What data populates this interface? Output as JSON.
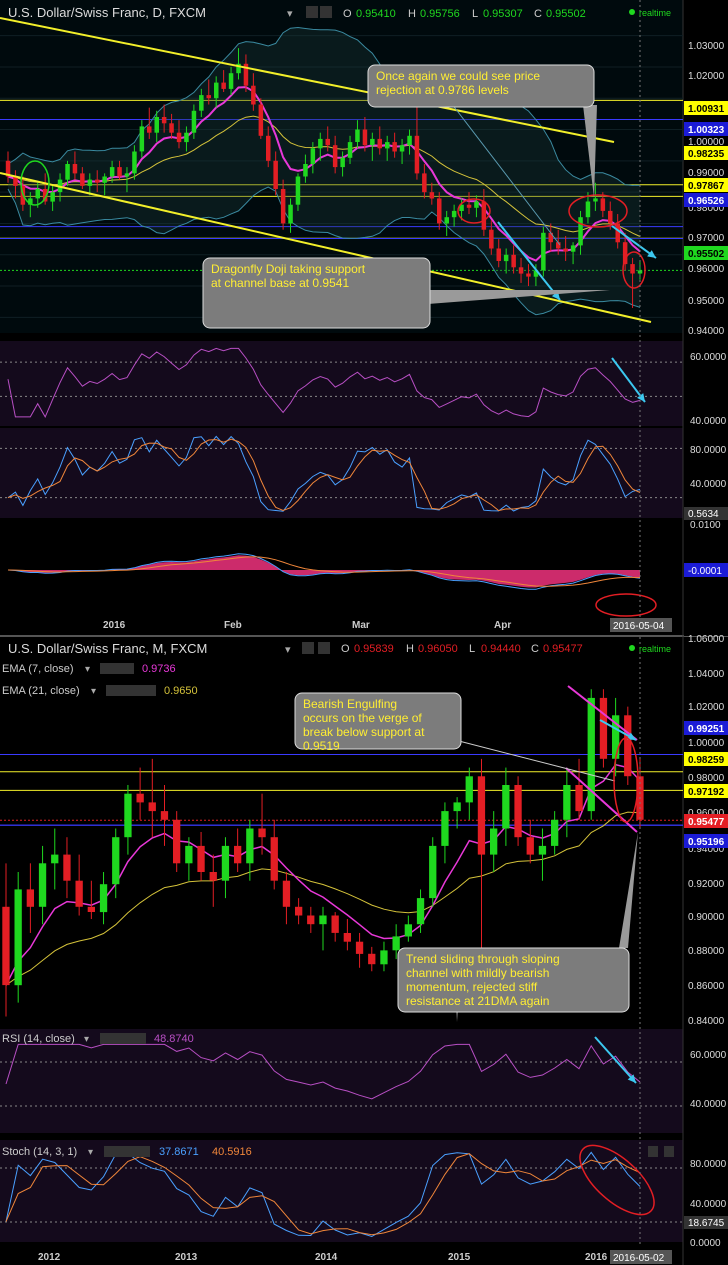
{
  "colors": {
    "bull": "#1fd81f",
    "bear": "#e31e24",
    "ema7": "#e838d8",
    "ema21": "#d4c23a",
    "trendline": "#f2ef2a",
    "arrow": "#3cc8f0",
    "rsi": "#b84fc4",
    "stoch_k": "#4aa0ff",
    "stoch_d": "#f0863a",
    "macd_hist": "#f0327e",
    "callout_bg": "#7c7c7c",
    "callout_text": "#ffee33"
  },
  "icons": [
    "dropdown-icon",
    "settings-icon",
    "close-icon",
    "realtime-dot-icon"
  ],
  "daily": {
    "title": "U.S. Dollar/Swiss Franc, D, FXCM",
    "o_label": "O",
    "o": "0.95410",
    "h_label": "H",
    "h": "0.95756",
    "l_label": "L",
    "l": "0.95307",
    "c_label": "C",
    "c": "0.95502",
    "realtime": "realtime",
    "price_ticks": [
      "1.03000",
      "1.02000",
      "1.01000",
      "1.00000",
      "0.99000",
      "0.98000",
      "0.97000",
      "0.96000",
      "0.95000",
      "0.94000"
    ],
    "price_tags": [
      {
        "text": "1.00931",
        "style": "yellow"
      },
      {
        "text": "1.00323",
        "style": "blue"
      },
      {
        "text": "0.98235",
        "style": "yellow"
      },
      {
        "text": "0.97867",
        "style": "yellow"
      },
      {
        "text": "0.96526",
        "style": "blue"
      },
      {
        "text": "0.95502",
        "style": "green"
      }
    ],
    "rsi_ticks": [
      "60.0000",
      "40.0000"
    ],
    "stoch_ticks": [
      "80.0000",
      "40.0000"
    ],
    "stoch_tag": "0.5634",
    "macd_ticks": [
      "0.0100"
    ],
    "macd_tag": "-0.0001",
    "x_labels": [
      "2016",
      "Feb",
      "Mar",
      "Apr"
    ],
    "date_tag": "2016-05-04",
    "callout_top": "Once again we could see price rejection at 0.9786 levels",
    "callout_bottom": "Dragonfly Doji taking support at channel base at 0.9541"
  },
  "monthly": {
    "title": "U.S. Dollar/Swiss Franc, M, FXCM",
    "o_label": "O",
    "o": "0.95839",
    "h_label": "H",
    "h": "0.96050",
    "l_label": "L",
    "l": "0.94440",
    "c_label": "C",
    "c": "0.95477",
    "realtime": "realtime",
    "ema7_label": "EMA (7, close)",
    "ema7_value": "0.9736",
    "ema21_label": "EMA (21, close)",
    "ema21_value": "0.9650",
    "price_ticks": [
      "1.06000",
      "1.04000",
      "1.02000",
      "1.00000",
      "0.98000",
      "0.96000",
      "0.94000",
      "0.92000",
      "0.90000",
      "0.88000",
      "0.86000",
      "0.84000"
    ],
    "price_tags": [
      {
        "text": "0.99251",
        "style": "blue"
      },
      {
        "text": "0.98259",
        "style": "yellow"
      },
      {
        "text": "0.97192",
        "style": "yellow"
      },
      {
        "text": "0.95477",
        "style": "red"
      },
      {
        "text": "0.95196",
        "style": "blue"
      }
    ],
    "rsi_label": "RSI (14, close)",
    "rsi_value": "48.8740",
    "rsi_ticks": [
      "60.0000",
      "40.0000"
    ],
    "stoch_label": "Stoch (14, 3, 1)",
    "stoch_k_value": "37.8671",
    "stoch_d_value": "40.5916",
    "stoch_ticks": [
      "80.0000",
      "40.0000",
      "0.0000"
    ],
    "stoch_tag": "18.6745",
    "x_labels": [
      "2012",
      "2013",
      "2014",
      "2015",
      "2016"
    ],
    "date_tag": "2016-05-02",
    "callout_top": "Bearish Engulfing occurs on the verge of break below support at 0.9519",
    "callout_bottom": "Trend sliding through sloping channel with mildly bearish momentum, rejected stiff resistance at 21DMA again"
  },
  "chart_data": [
    {
      "type": "candlestick",
      "title": "U.S. Dollar/Swiss Franc, D, FXCM",
      "timeframe": "daily",
      "x_range": [
        "2015-12-21",
        "2016-05-04"
      ],
      "ylim": [
        0.935,
        1.035
      ],
      "candles_ohlc": [
        [
          0.99,
          0.993,
          0.983,
          0.985
        ],
        [
          0.985,
          0.987,
          0.978,
          0.982
        ],
        [
          0.982,
          0.985,
          0.974,
          0.976
        ],
        [
          0.976,
          0.98,
          0.972,
          0.978
        ],
        [
          0.978,
          0.983,
          0.975,
          0.981
        ],
        [
          0.981,
          0.986,
          0.976,
          0.977
        ],
        [
          0.977,
          0.982,
          0.974,
          0.98
        ],
        [
          0.98,
          0.986,
          0.977,
          0.984
        ],
        [
          0.984,
          0.99,
          0.982,
          0.989
        ],
        [
          0.989,
          0.993,
          0.984,
          0.986
        ],
        [
          0.986,
          0.988,
          0.981,
          0.982
        ],
        [
          0.982,
          0.986,
          0.979,
          0.984
        ],
        [
          0.984,
          0.987,
          0.98,
          0.983
        ],
        [
          0.983,
          0.986,
          0.979,
          0.985
        ],
        [
          0.985,
          0.99,
          0.983,
          0.988
        ],
        [
          0.988,
          0.99,
          0.984,
          0.985
        ],
        [
          0.985,
          0.988,
          0.98,
          0.986
        ],
        [
          0.986,
          0.995,
          0.984,
          0.993
        ],
        [
          0.993,
          1.003,
          0.991,
          1.001
        ],
        [
          1.001,
          1.007,
          0.997,
          0.999
        ],
        [
          0.999,
          1.006,
          0.996,
          1.004
        ],
        [
          1.004,
          1.008,
          0.999,
          1.002
        ],
        [
          1.002,
          1.005,
          0.997,
          0.999
        ],
        [
          0.999,
          1.003,
          0.994,
          0.996
        ],
        [
          0.996,
          1.001,
          0.993,
          0.999
        ],
        [
          0.999,
          1.008,
          0.997,
          1.006
        ],
        [
          1.006,
          1.013,
          1.004,
          1.011
        ],
        [
          1.011,
          1.016,
          1.008,
          1.01
        ],
        [
          1.01,
          1.017,
          1.007,
          1.015
        ],
        [
          1.015,
          1.019,
          1.012,
          1.013
        ],
        [
          1.013,
          1.02,
          1.011,
          1.018
        ],
        [
          1.018,
          1.026,
          1.016,
          1.021
        ],
        [
          1.021,
          1.024,
          1.012,
          1.014
        ],
        [
          1.014,
          1.018,
          1.006,
          1.008
        ],
        [
          1.008,
          1.01,
          0.997,
          0.998
        ],
        [
          0.998,
          1.001,
          0.988,
          0.99
        ],
        [
          0.99,
          0.993,
          0.979,
          0.981
        ],
        [
          0.981,
          0.984,
          0.968,
          0.97
        ],
        [
          0.97,
          0.978,
          0.967,
          0.976
        ],
        [
          0.976,
          0.986,
          0.974,
          0.985
        ],
        [
          0.985,
          0.992,
          0.983,
          0.989
        ],
        [
          0.989,
          0.996,
          0.986,
          0.994
        ],
        [
          0.994,
          0.999,
          0.99,
          0.997
        ],
        [
          0.997,
          1.001,
          0.993,
          0.995
        ],
        [
          0.995,
          0.998,
          0.986,
          0.988
        ],
        [
          0.988,
          0.993,
          0.985,
          0.991
        ],
        [
          0.991,
          0.998,
          0.989,
          0.996
        ],
        [
          0.996,
          1.003,
          0.994,
          1.0
        ],
        [
          1.0,
          1.004,
          0.993,
          0.995
        ],
        [
          0.995,
          0.999,
          0.99,
          0.997
        ],
        [
          0.997,
          1.001,
          0.992,
          0.994
        ],
        [
          0.994,
          0.998,
          0.99,
          0.996
        ],
        [
          0.996,
          0.999,
          0.991,
          0.993
        ],
        [
          0.993,
          0.997,
          0.989,
          0.995
        ],
        [
          0.995,
          1.0,
          0.992,
          0.998
        ],
        [
          0.998,
          1.009,
          0.984,
          0.986
        ],
        [
          0.986,
          0.989,
          0.978,
          0.98
        ],
        [
          0.98,
          0.983,
          0.976,
          0.978
        ],
        [
          0.978,
          0.98,
          0.968,
          0.97
        ],
        [
          0.97,
          0.974,
          0.966,
          0.972
        ],
        [
          0.972,
          0.976,
          0.969,
          0.974
        ],
        [
          0.974,
          0.978,
          0.971,
          0.976
        ],
        [
          0.976,
          0.98,
          0.973,
          0.975
        ],
        [
          0.975,
          0.979,
          0.972,
          0.977
        ],
        [
          0.977,
          0.981,
          0.966,
          0.968
        ],
        [
          0.968,
          0.971,
          0.96,
          0.962
        ],
        [
          0.962,
          0.965,
          0.956,
          0.958
        ],
        [
          0.958,
          0.962,
          0.954,
          0.96
        ],
        [
          0.96,
          0.963,
          0.954,
          0.956
        ],
        [
          0.956,
          0.959,
          0.951,
          0.954
        ],
        [
          0.954,
          0.957,
          0.95,
          0.953
        ],
        [
          0.953,
          0.957,
          0.95,
          0.955
        ],
        [
          0.955,
          0.969,
          0.953,
          0.967
        ],
        [
          0.967,
          0.97,
          0.961,
          0.964
        ],
        [
          0.964,
          0.968,
          0.96,
          0.962
        ],
        [
          0.962,
          0.966,
          0.958,
          0.961
        ],
        [
          0.961,
          0.964,
          0.957,
          0.963
        ],
        [
          0.963,
          0.974,
          0.96,
          0.972
        ],
        [
          0.972,
          0.98,
          0.97,
          0.977
        ],
        [
          0.977,
          0.983,
          0.974,
          0.978
        ],
        [
          0.978,
          0.98,
          0.972,
          0.974
        ],
        [
          0.974,
          0.977,
          0.968,
          0.97
        ],
        [
          0.97,
          0.973,
          0.962,
          0.964
        ],
        [
          0.964,
          0.967,
          0.955,
          0.957
        ],
        [
          0.957,
          0.959,
          0.943,
          0.954
        ],
        [
          0.954,
          0.958,
          0.952,
          0.955
        ]
      ],
      "overlays": [
        "EMA",
        "EMA",
        "Bollinger Bands"
      ],
      "rsi_range": [
        25,
        70
      ],
      "stoch_range": [
        0,
        100
      ],
      "macd_zero": "-0.0001"
    },
    {
      "type": "candlestick",
      "title": "U.S. Dollar/Swiss Franc, M, FXCM",
      "timeframe": "monthly",
      "x_range": [
        "2011-08",
        "2016-05"
      ],
      "ylim": [
        0.84,
        1.06
      ],
      "candles_ohlc": [
        [
          0.905,
          0.93,
          0.842,
          0.86
        ],
        [
          0.86,
          0.925,
          0.85,
          0.915
        ],
        [
          0.915,
          0.93,
          0.89,
          0.905
        ],
        [
          0.905,
          0.94,
          0.895,
          0.93
        ],
        [
          0.93,
          0.95,
          0.915,
          0.935
        ],
        [
          0.935,
          0.945,
          0.91,
          0.92
        ],
        [
          0.92,
          0.935,
          0.9,
          0.905
        ],
        [
          0.905,
          0.92,
          0.898,
          0.902
        ],
        [
          0.902,
          0.925,
          0.895,
          0.918
        ],
        [
          0.918,
          0.95,
          0.91,
          0.945
        ],
        [
          0.945,
          0.975,
          0.935,
          0.97
        ],
        [
          0.97,
          0.985,
          0.955,
          0.965
        ],
        [
          0.965,
          0.99,
          0.945,
          0.96
        ],
        [
          0.96,
          0.975,
          0.94,
          0.955
        ],
        [
          0.955,
          0.96,
          0.925,
          0.93
        ],
        [
          0.93,
          0.945,
          0.92,
          0.94
        ],
        [
          0.94,
          0.948,
          0.92,
          0.925
        ],
        [
          0.925,
          0.935,
          0.905,
          0.92
        ],
        [
          0.92,
          0.945,
          0.91,
          0.94
        ],
        [
          0.94,
          0.95,
          0.925,
          0.93
        ],
        [
          0.93,
          0.955,
          0.92,
          0.95
        ],
        [
          0.95,
          0.97,
          0.935,
          0.945
        ],
        [
          0.945,
          0.955,
          0.915,
          0.92
        ],
        [
          0.92,
          0.925,
          0.895,
          0.905
        ],
        [
          0.905,
          0.91,
          0.895,
          0.9
        ],
        [
          0.9,
          0.905,
          0.89,
          0.895
        ],
        [
          0.895,
          0.905,
          0.88,
          0.9
        ],
        [
          0.9,
          0.902,
          0.885,
          0.89
        ],
        [
          0.89,
          0.898,
          0.88,
          0.885
        ],
        [
          0.885,
          0.89,
          0.87,
          0.878
        ],
        [
          0.878,
          0.882,
          0.868,
          0.872
        ],
        [
          0.872,
          0.885,
          0.868,
          0.88
        ],
        [
          0.88,
          0.895,
          0.875,
          0.888
        ],
        [
          0.888,
          0.9,
          0.885,
          0.895
        ],
        [
          0.895,
          0.915,
          0.89,
          0.91
        ],
        [
          0.91,
          0.945,
          0.905,
          0.94
        ],
        [
          0.94,
          0.965,
          0.93,
          0.96
        ],
        [
          0.96,
          0.968,
          0.95,
          0.965
        ],
        [
          0.965,
          0.985,
          0.955,
          0.98
        ],
        [
          0.98,
          0.99,
          0.845,
          0.935
        ],
        [
          0.935,
          0.96,
          0.925,
          0.95
        ],
        [
          0.95,
          0.985,
          0.94,
          0.975
        ],
        [
          0.975,
          0.98,
          0.94,
          0.945
        ],
        [
          0.945,
          0.955,
          0.93,
          0.935
        ],
        [
          0.935,
          0.95,
          0.92,
          0.94
        ],
        [
          0.94,
          0.96,
          0.935,
          0.955
        ],
        [
          0.955,
          0.985,
          0.945,
          0.975
        ],
        [
          0.975,
          0.99,
          0.955,
          0.96
        ],
        [
          0.96,
          1.03,
          0.955,
          1.025
        ],
        [
          1.025,
          1.03,
          0.985,
          0.99
        ],
        [
          0.99,
          1.025,
          0.98,
          1.015
        ],
        [
          1.015,
          1.02,
          0.975,
          0.98
        ],
        [
          0.98,
          0.99,
          0.95,
          0.955
        ]
      ],
      "overlays": [
        "EMA (7, close) 0.9736",
        "EMA (21, close) 0.9650"
      ],
      "rsi_current": 48.874,
      "stoch_current": {
        "k": 37.8671,
        "d": 40.5916
      }
    }
  ]
}
